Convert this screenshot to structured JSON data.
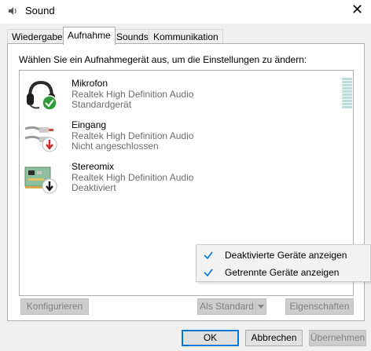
{
  "window": {
    "title": "Sound",
    "icon": "speaker-icon",
    "close_glyph": "✕"
  },
  "tabs": [
    {
      "label": "Wiedergabe",
      "active": false
    },
    {
      "label": "Aufnahme",
      "active": true
    },
    {
      "label": "Sounds",
      "active": false
    },
    {
      "label": "Kommunikation",
      "active": false
    }
  ],
  "instruction": "Wählen Sie ein Aufnahmegerät aus, um die Einstellungen zu ändern:",
  "devices": [
    {
      "name": "Mikrofon",
      "driver": "Realtek High Definition Audio",
      "status": "Standardgerät",
      "icon": "headset-icon",
      "badge": "green-check-badge"
    },
    {
      "name": "Eingang",
      "driver": "Realtek High Definition Audio",
      "status": "Nicht angeschlossen",
      "icon": "rca-cable-icon",
      "badge": "red-down-arrow-badge"
    },
    {
      "name": "Stereomix",
      "driver": "Realtek High Definition Audio",
      "status": "Deaktiviert",
      "icon": "sound-card-icon",
      "badge": "black-down-arrow-badge"
    }
  ],
  "level_meter": {
    "level": 0,
    "segments": 10
  },
  "context_menu": [
    {
      "label": "Deaktivierte Geräte anzeigen",
      "checked": true
    },
    {
      "label": "Getrennte Geräte anzeigen",
      "checked": true
    }
  ],
  "buttons": {
    "configure": "Konfigurieren",
    "set_default": "Als Standard",
    "properties": "Eigenschaften",
    "ok": "OK",
    "cancel": "Abbrechen",
    "apply": "Übernehmen"
  },
  "colors": {
    "accent": "#0078d7",
    "check": "#0078d7",
    "level": "#b9dedb"
  }
}
